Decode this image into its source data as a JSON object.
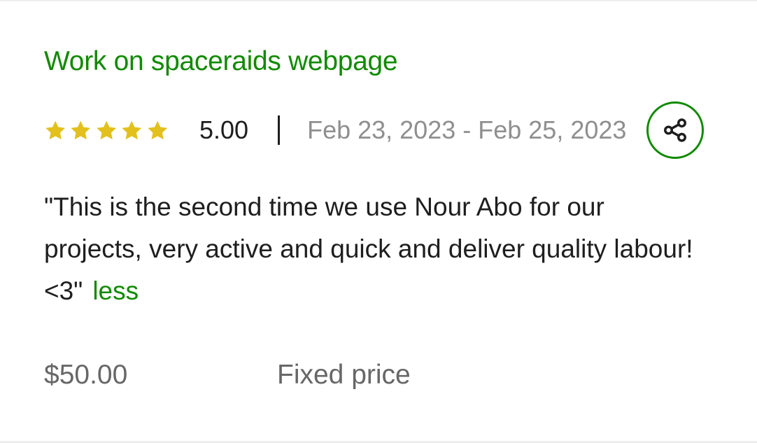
{
  "job": {
    "title": "Work on spaceraids webpage"
  },
  "rating": {
    "value": "5.00",
    "stars": 5,
    "max_stars": 5,
    "star_color": "#e3c01c"
  },
  "date_range": "Feb 23, 2023 - Feb 25, 2023",
  "share": {
    "icon": "share-icon"
  },
  "feedback": {
    "text": "\"This is the second time we use Nour Abo for our projects, very active and quick and deliver quality labour! <3\"",
    "toggle_label": "less"
  },
  "payment": {
    "amount": "$50.00",
    "type": "Fixed price"
  },
  "colors": {
    "accent": "#108a00",
    "muted_text": "#8f8f8f",
    "price_text": "#676767"
  }
}
